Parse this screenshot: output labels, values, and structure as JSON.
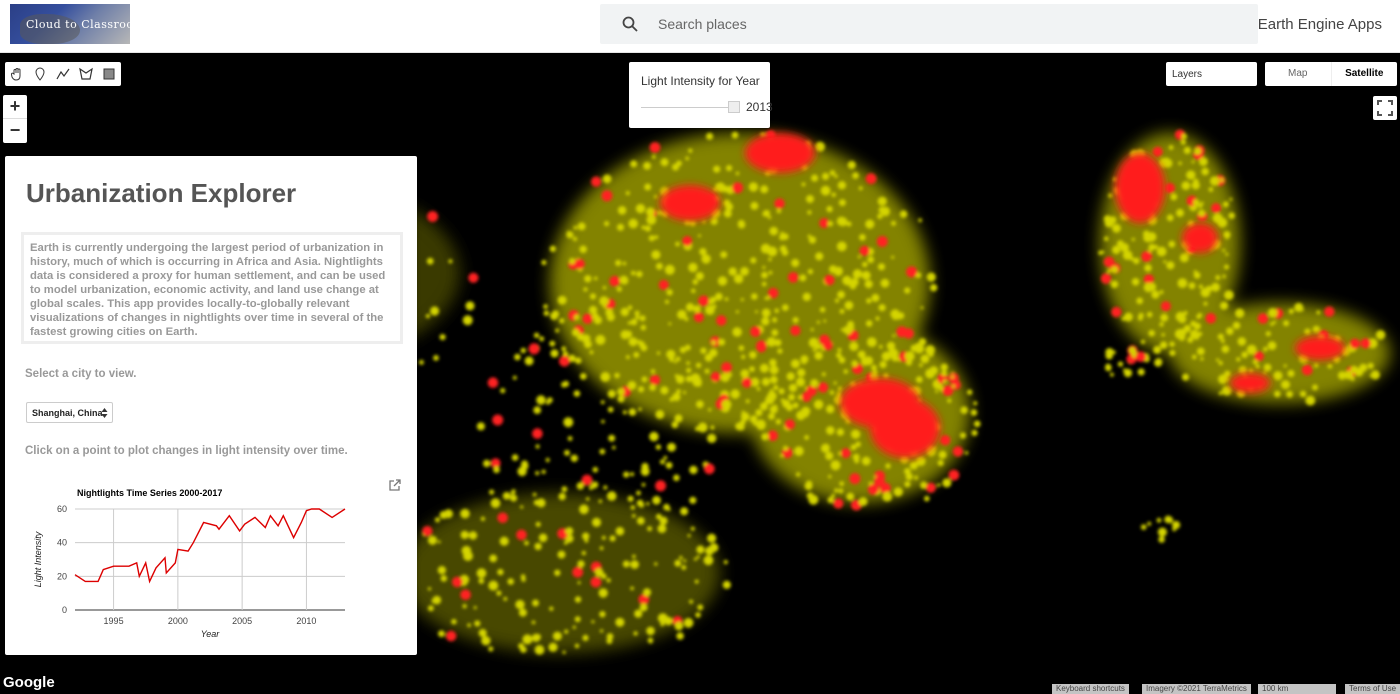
{
  "header": {
    "logo_text": "Cloud to Classroom",
    "search_placeholder": "Search places",
    "apps_link": "Earth Engine Apps"
  },
  "map": {
    "year_panel": {
      "title": "Light Intensity for Year",
      "year": "2013"
    },
    "layers_label": "Layers",
    "maptype": {
      "map": "Map",
      "satellite": "Satellite"
    },
    "google_label": "Google",
    "attribution": {
      "shortcuts": "Keyboard shortcuts",
      "imagery": "Imagery ©2021 TerraMetrics",
      "scale": "100 km",
      "terms": "Terms of Use"
    },
    "colors": {
      "background": "#000000",
      "glow": "#c8c800",
      "hot": "#ff2020"
    }
  },
  "panel": {
    "title": "Urbanization Explorer",
    "description": "Earth is currently undergoing the largest period of urbanization in history, much of which is occurring in Africa and Asia. Nightlights data is considered a proxy for human settlement, and can be used to model urbanization, economic activity, and land use change at global scales. This app provides locally-to-globally relevant visualizations of changes in nightlights over time in several of the fastest growing cities on Earth.",
    "select_label": "Select a city to view.",
    "selected_city": "Shanghai, China",
    "click_label": "Click on a point to plot changes in light intensity over time."
  },
  "chart_data": {
    "type": "line",
    "title": "Nightlights Time Series 2000-2017",
    "xlabel": "Year",
    "ylabel": "Light Intensity",
    "xlim": [
      1992,
      2013
    ],
    "ylim": [
      0,
      60
    ],
    "xticks": [
      1995,
      2000,
      2005,
      2010
    ],
    "yticks": [
      0,
      20,
      40,
      60
    ],
    "series": [
      {
        "color": "#dd0000",
        "x": [
          1992.0,
          1992.8,
          1993.8,
          1994.2,
          1995.0,
          1996.2,
          1996.8,
          1997.0,
          1997.5,
          1997.8,
          1998.3,
          1999.0,
          1999.1,
          1999.8,
          2000.0,
          2000.8,
          2001.2,
          2002.0,
          2003.0,
          2003.2,
          2004.0,
          2004.8,
          2005.2,
          2006.0,
          2006.8,
          2007.2,
          2007.8,
          2008.2,
          2009.0,
          2009.6,
          2010.0,
          2010.4,
          2011.0,
          2012.0,
          2013.0
        ],
        "y": [
          21,
          17,
          17,
          24,
          26,
          26,
          28,
          20,
          28,
          17,
          25,
          31,
          22,
          28,
          36,
          35,
          40,
          52,
          50,
          48,
          56,
          47,
          51,
          55,
          49,
          56,
          50,
          56,
          43,
          52,
          59,
          60,
          60,
          55,
          60
        ]
      }
    ]
  }
}
